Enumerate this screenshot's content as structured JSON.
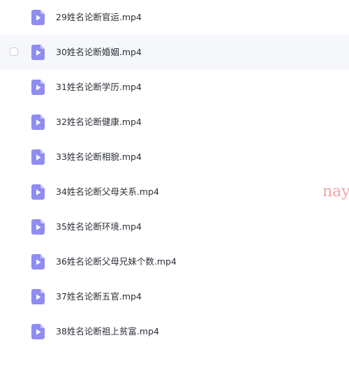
{
  "files": [
    {
      "name": "29姓名论断官运.mp4",
      "icon": "video-file-icon"
    },
    {
      "name": "30姓名论断婚姻.mp4",
      "icon": "video-file-icon",
      "hovered": true
    },
    {
      "name": "31姓名论断学历.mp4",
      "icon": "video-file-icon"
    },
    {
      "name": "32姓名论断健康.mp4",
      "icon": "video-file-icon"
    },
    {
      "name": "33姓名论断相貌.mp4",
      "icon": "video-file-icon"
    },
    {
      "name": "34姓名论断父母关系.mp4",
      "icon": "video-file-icon"
    },
    {
      "name": "35姓名论断环境.mp4",
      "icon": "video-file-icon"
    },
    {
      "name": "36姓名论断父母兄妹个数.mp4",
      "icon": "video-file-icon"
    },
    {
      "name": "37姓名论断五官.mp4",
      "icon": "video-file-icon"
    },
    {
      "name": "38姓名论断祖上贫富.mp4",
      "icon": "video-file-icon"
    }
  ],
  "watermark": "nay",
  "colors": {
    "icon_body": "#8f8cf2",
    "icon_fold": "#c7c5fb",
    "hover_background": "#f6f7fb",
    "text": "#2b2f36",
    "watermark": "#f4a3a3"
  }
}
